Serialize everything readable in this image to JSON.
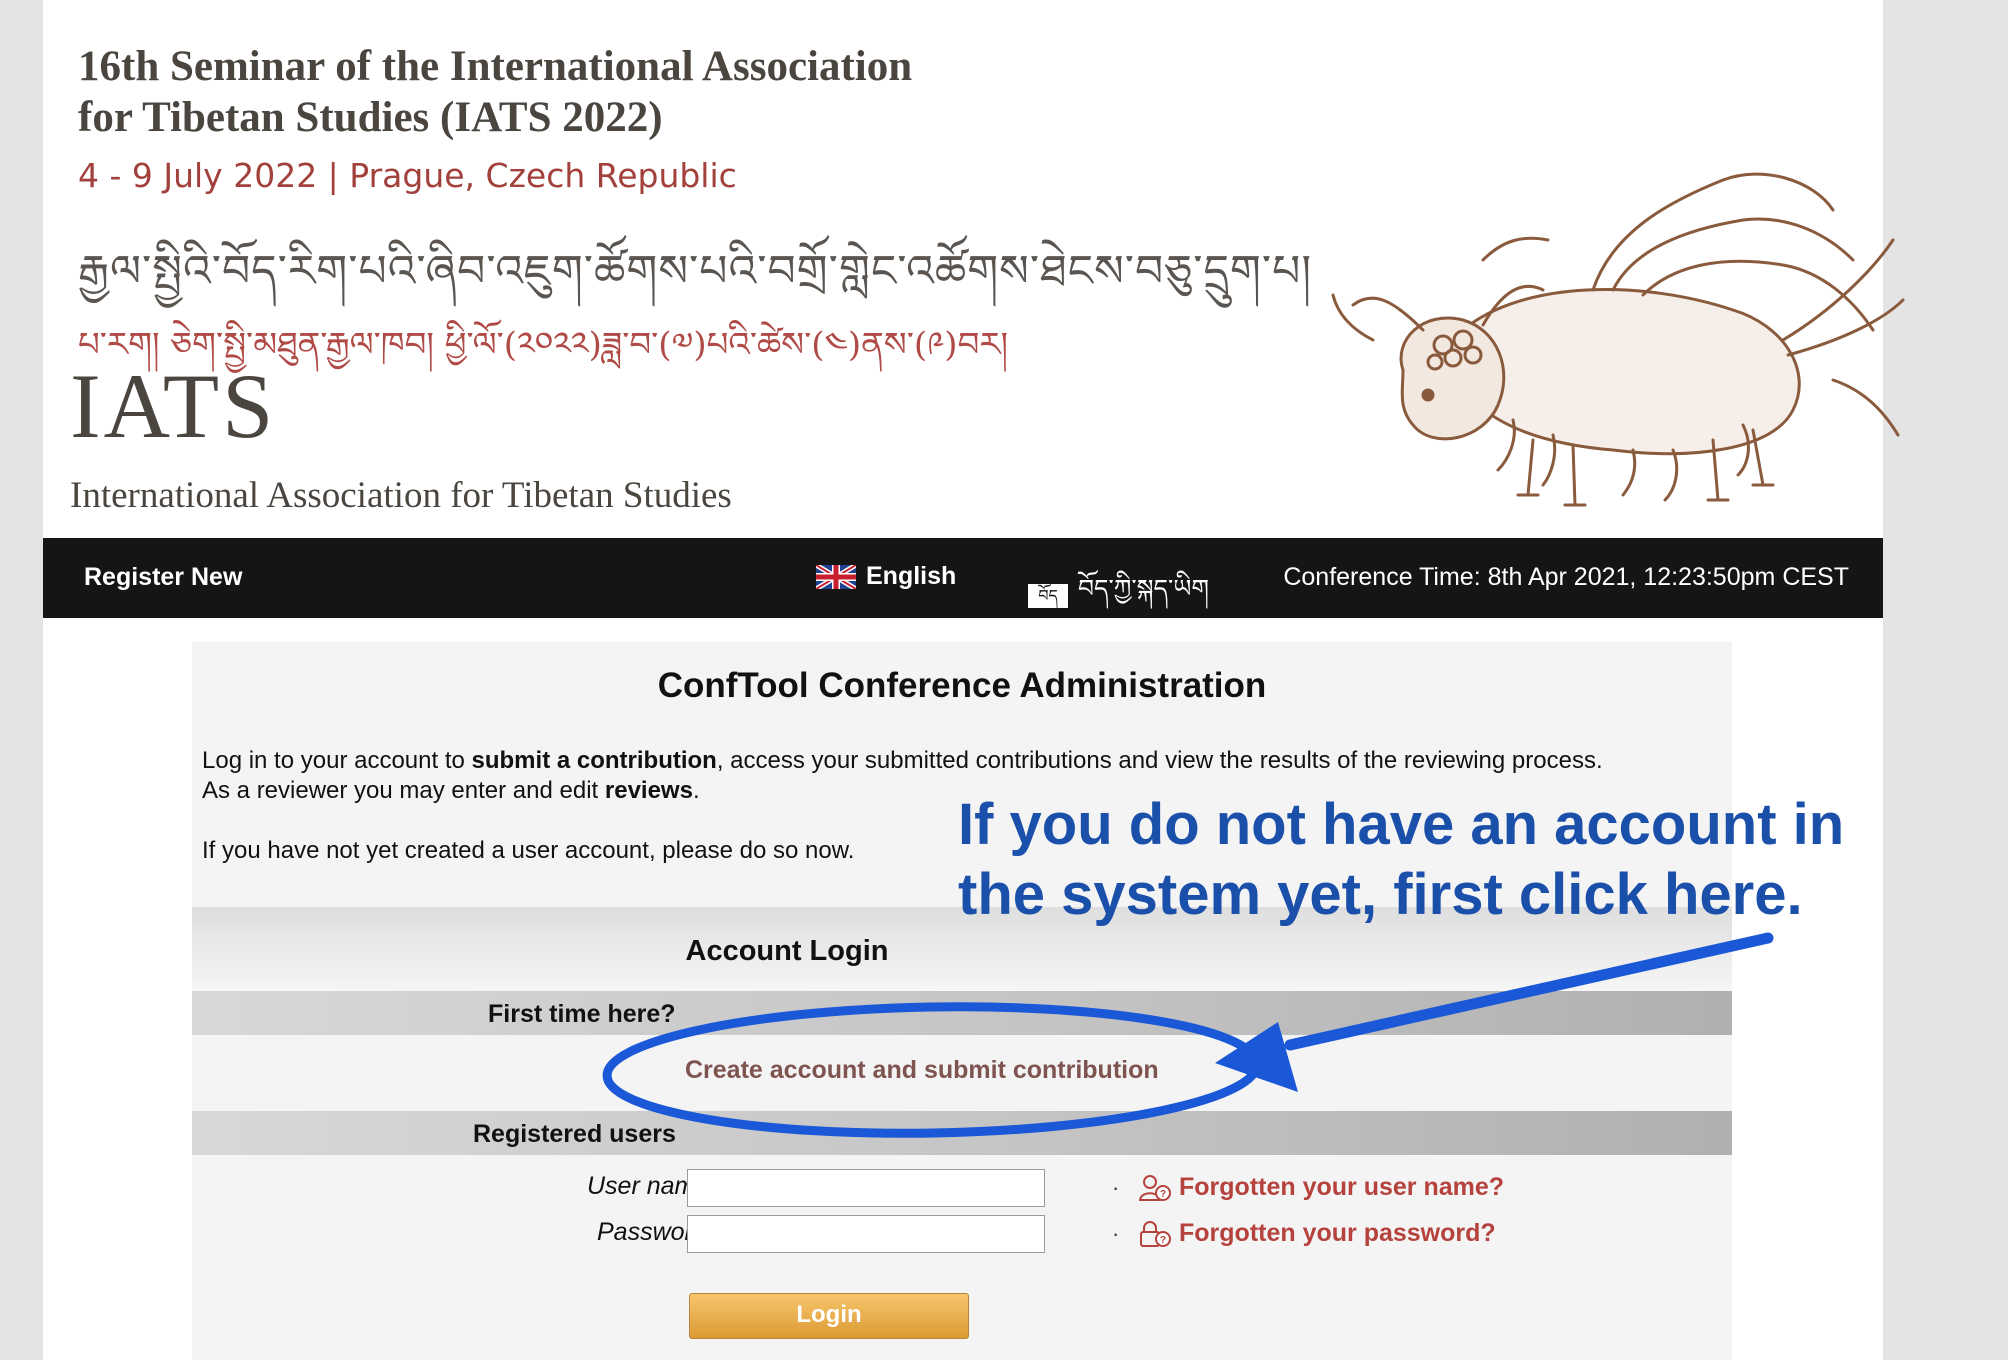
{
  "banner": {
    "title_line_1": "16th Seminar of the International Association",
    "title_line_2": "for Tibetan Studies (IATS 2022)",
    "subtitle": "4 - 9 July 2022 | Prague, Czech Republic",
    "tibetan_title": "རྒྱལ་སྤྱིའི་བོད་རིག་པའི་ཞིབ་འཇུག་ཚོགས་པའི་བགྲོ་གླེང་འཚོགས་ཐེངས་བཅུ་དྲུག་པ།",
    "tibetan_date": "པ་རག། ཅེག་སྤྱི་མཐུན་རྒྱལ་ཁབ། ཕྱི་ལོ་(༢༠༢༢)ཟླ་བ་(༧)པའི་ཚེས་(༤)ནས་(༩)བར།",
    "logo_text": "IATS",
    "org_name": "International Association for Tibetan Studies",
    "illustration": "yak-illustration"
  },
  "navbar": {
    "register_new": "Register New",
    "lang_english": "English",
    "lang_tibetan": "བོད་ཀྱི་སྐད་ཡིག",
    "lang_tibetan_flag": "བོད",
    "conference_time_label": "Conference Time:",
    "conference_time_value": "8th Apr 2021, 12:23:50pm",
    "conference_time_zone": "CEST"
  },
  "main": {
    "title": "ConfTool Conference Administration",
    "intro_1_pre": "Log in to your account to ",
    "intro_1_bold": "submit a contribution",
    "intro_1_post": ", access your submitted contributions and view the results of the reviewing process.",
    "intro_2_pre": "As a reviewer you may enter and edit ",
    "intro_2_bold": "reviews",
    "intro_2_post": ".",
    "intro_3": "If you have not yet created a user account, please do so now."
  },
  "login": {
    "header": "Account Login",
    "first_time_label": "First time here?",
    "create_link": "Create account and submit contribution",
    "registered_label": "Registered users",
    "username_label": "User name:",
    "username_value": "",
    "password_label": "Password:",
    "password_value": "",
    "separator": "·",
    "forgot_username": "Forgotten your user name?",
    "forgot_password": "Forgotten your password?",
    "login_button": "Login"
  },
  "annotation": {
    "line_1": "If you do not have an account in",
    "line_2": "the system yet, first click here.",
    "color": "#1a4faa"
  },
  "colors": {
    "nav_bg": "#151515",
    "link_brown": "#7f5450",
    "link_red": "#b5423c",
    "subtitle_red": "#a2403b",
    "button_orange": "#dc9a34"
  }
}
